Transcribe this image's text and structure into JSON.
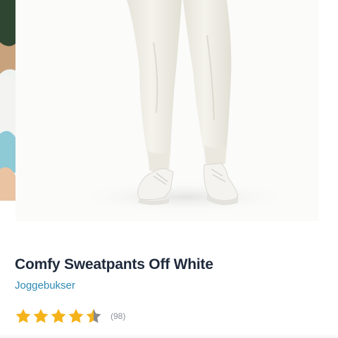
{
  "product": {
    "title": "Comfy Sweatpants Off White",
    "category": "Joggebukser",
    "rating": {
      "value": 4.5,
      "max": 5,
      "count_label": "(98)"
    }
  },
  "colors": {
    "title": "#1f2a3c",
    "link": "#2f8ab4",
    "star_filled": "#f5b31b",
    "star_empty": "#8a8a8a"
  },
  "icons": {
    "star": "star-icon"
  }
}
